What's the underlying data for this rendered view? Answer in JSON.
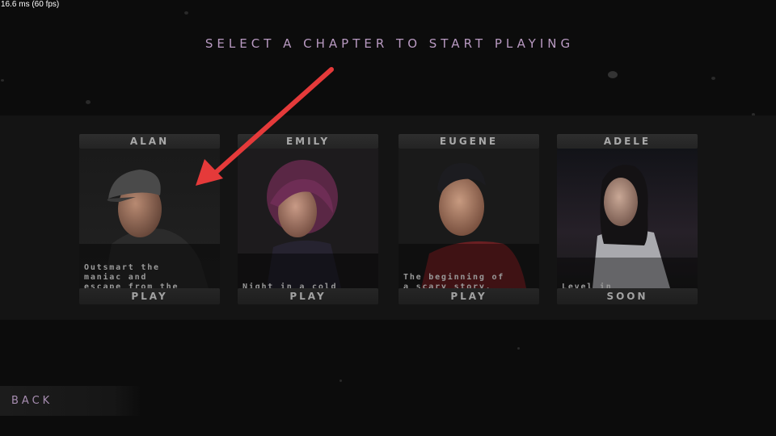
{
  "debug": {
    "fps": "16.6 ms (60 fps)"
  },
  "heading": "SELECT A CHAPTER TO START PLAYING",
  "chapters": [
    {
      "name": "ALAN",
      "description": "Outsmart the\nmaniac and\nescape from the\nhouse.",
      "action": "PLAY"
    },
    {
      "name": "EMILY",
      "description": "Night in a cold\nbasement.",
      "action": "PLAY"
    },
    {
      "name": "EUGENE",
      "description": "The beginning of\na scary story.\nBeta.",
      "action": "PLAY"
    },
    {
      "name": "ADELE",
      "description": "Level in\ndevelopment.",
      "action": "SOON"
    }
  ],
  "back_label": "BACK",
  "colors": {
    "heading": "#b99ac2",
    "back": "#a88eb2",
    "arrow": "#e53a3a"
  }
}
